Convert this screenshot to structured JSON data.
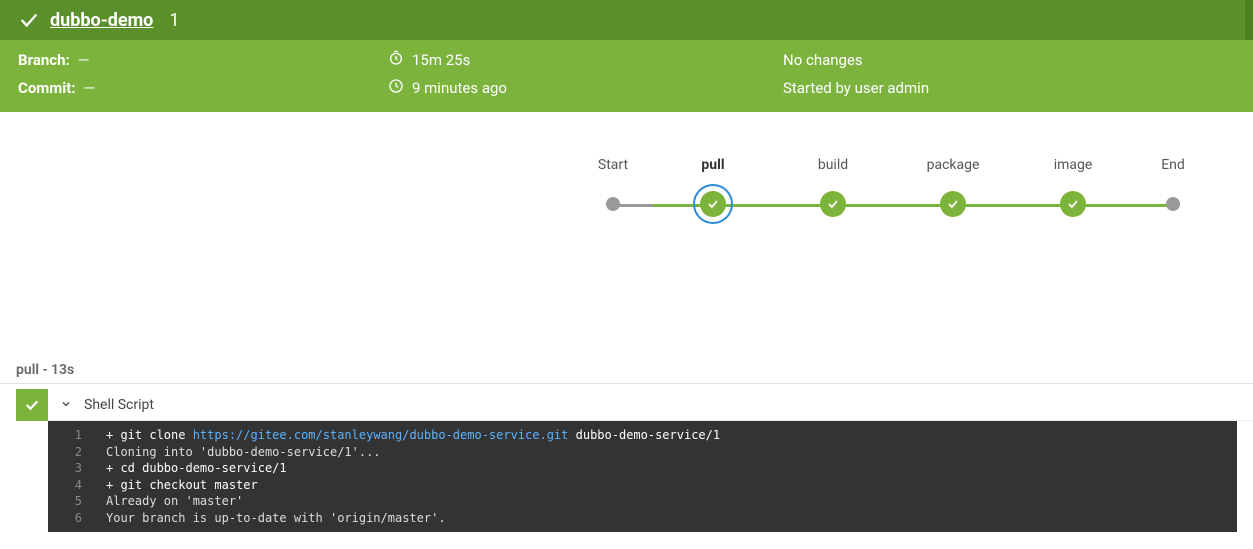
{
  "header": {
    "title": "dubbo-demo",
    "run_number": "1"
  },
  "info": {
    "branch_label": "Branch:",
    "branch_value": "—",
    "commit_label": "Commit:",
    "commit_value": "—",
    "duration": "15m 25s",
    "time_ago": "9 minutes ago",
    "changes": "No changes",
    "started_by": "Started by user admin"
  },
  "pipeline": {
    "stages": [
      {
        "label": "Start",
        "type": "terminal"
      },
      {
        "label": "pull",
        "type": "success",
        "selected": true
      },
      {
        "label": "build",
        "type": "success"
      },
      {
        "label": "package",
        "type": "success"
      },
      {
        "label": "image",
        "type": "success"
      },
      {
        "label": "End",
        "type": "terminal"
      }
    ]
  },
  "stage_detail": {
    "title": "pull - 13s",
    "step_name": "Shell Script",
    "log_lines": [
      {
        "n": "1",
        "segments": [
          {
            "t": "+ git clone ",
            "c": "cmd"
          },
          {
            "t": "https://gitee.com/stanleywang/dubbo-demo-service.git",
            "c": "url"
          },
          {
            "t": " dubbo-demo-service/1",
            "c": "cmd"
          }
        ]
      },
      {
        "n": "2",
        "segments": [
          {
            "t": "Cloning into 'dubbo-demo-service/1'...",
            "c": "plain"
          }
        ]
      },
      {
        "n": "3",
        "segments": [
          {
            "t": "+ cd dubbo-demo-service/1",
            "c": "cmd"
          }
        ]
      },
      {
        "n": "4",
        "segments": [
          {
            "t": "+ git checkout master",
            "c": "cmd"
          }
        ]
      },
      {
        "n": "5",
        "segments": [
          {
            "t": "Already on 'master'",
            "c": "plain"
          }
        ]
      },
      {
        "n": "6",
        "segments": [
          {
            "t": "Your branch is up-to-date with 'origin/master'.",
            "c": "plain"
          }
        ]
      }
    ]
  }
}
